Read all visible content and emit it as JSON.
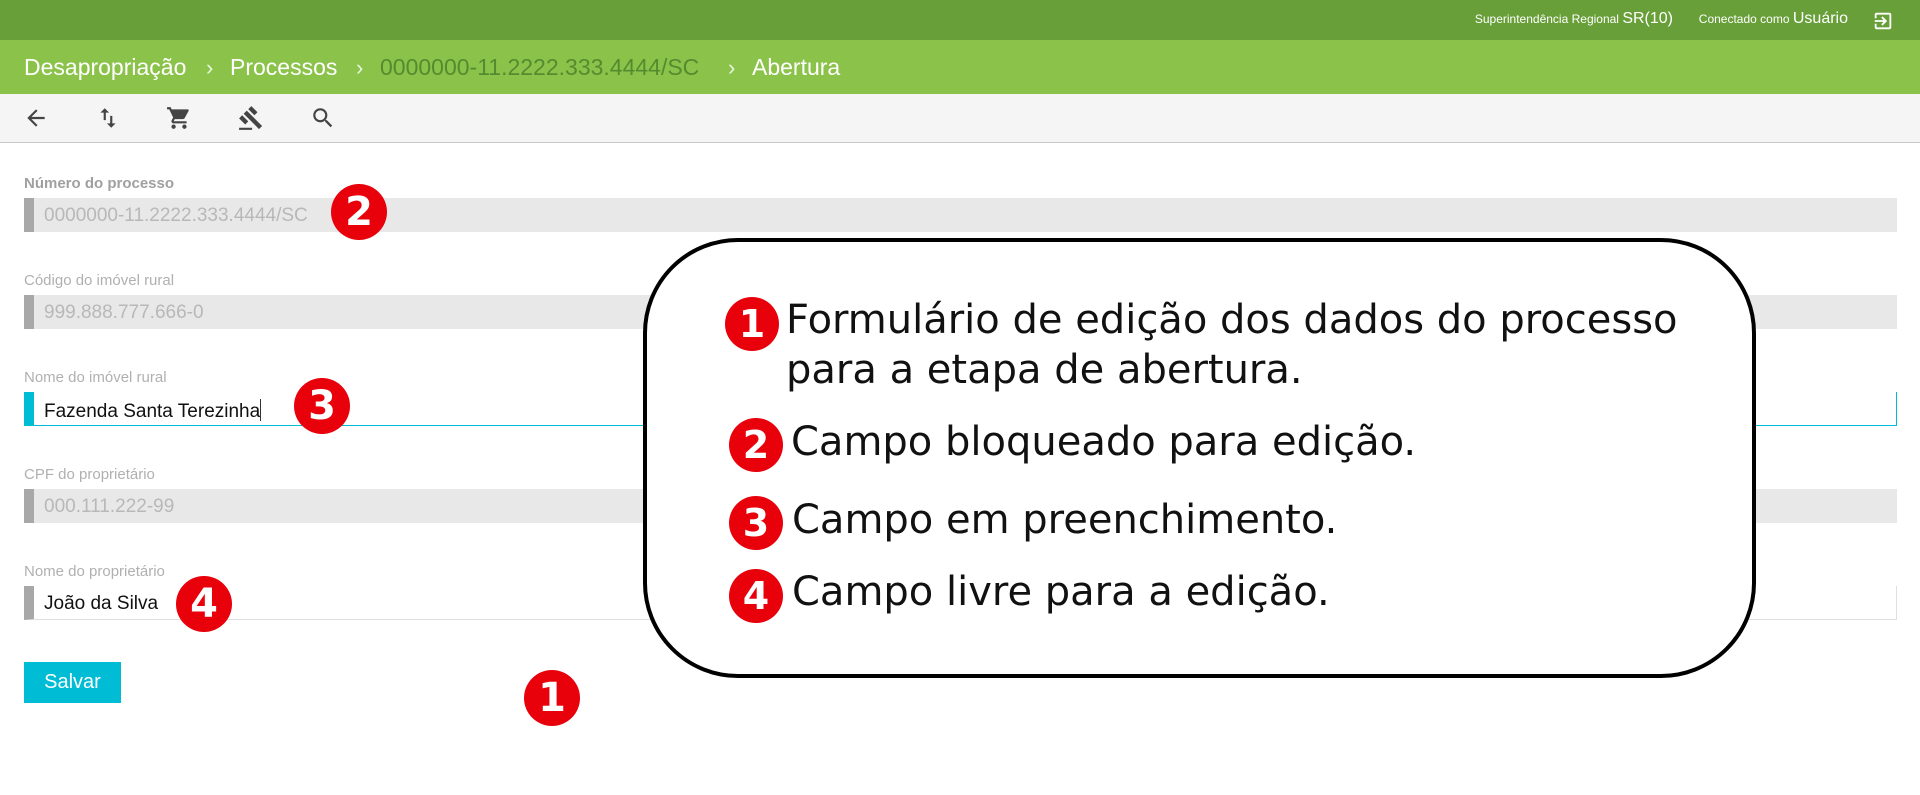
{
  "topbar": {
    "region_prefix": "Superintendência Regional",
    "region_value": "SR(10)",
    "user_prefix": "Conectado como",
    "user_value": "Usuário",
    "logout_icon": "logout-icon"
  },
  "breadcrumb": {
    "items": [
      "Desapropriação",
      "Processos",
      "0000000-11.2222.333.4444/SC",
      "Abertura"
    ],
    "separator": "›"
  },
  "toolbar": {
    "icons": [
      "arrow-back-icon",
      "swap-vert-icon",
      "cart-icon",
      "gavel-icon",
      "search-icon"
    ]
  },
  "form": {
    "fields": [
      {
        "label": "Número do processo",
        "value": "0000000-11.2222.333.4444/SC",
        "state": "locked"
      },
      {
        "label": "Código do imóvel rural",
        "value": "999.888.777.666-0",
        "state": "locked"
      },
      {
        "label": "Nome do imóvel rural",
        "value": "Fazenda Santa Terezinha",
        "state": "active"
      },
      {
        "label": "CPF do proprietário",
        "value": "000.111.222-99",
        "state": "locked"
      },
      {
        "label": "Nome do proprietário",
        "value": "João da Silva",
        "state": "free"
      }
    ],
    "save_label": "Salvar"
  },
  "annotations": {
    "badges": [
      "1",
      "2",
      "3",
      "4"
    ],
    "callout": [
      {
        "num": "1",
        "text_line1": "Formulário de edição dos dados do processo",
        "text_line2": "para a etapa de abertura."
      },
      {
        "num": "2",
        "text": "Campo bloqueado para edição."
      },
      {
        "num": "3",
        "text": "Campo em preenchimento."
      },
      {
        "num": "4",
        "text": "Campo livre para a edição."
      }
    ]
  },
  "colors": {
    "topbar": "#689f38",
    "breadbar": "#8bc34a",
    "accent": "#00bcd4",
    "badge": "#e8000b"
  }
}
